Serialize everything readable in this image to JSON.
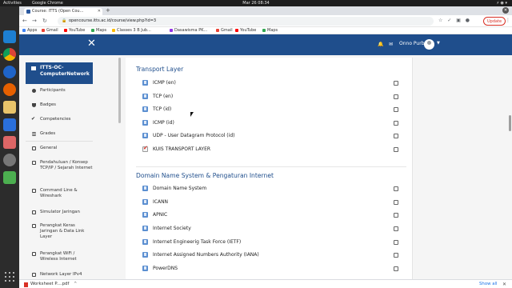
{
  "os": {
    "activities": "Activities",
    "app_name": "Google Chrome",
    "clock": "Mar 26  08:34"
  },
  "browser": {
    "tab_title": "Course: ITTS (Open Cou...",
    "url": "opencourse.itts.ac.id/course/view.php?id=3",
    "update_label": "Update",
    "bookmarks": [
      "Apps",
      "Gmail",
      "YouTube",
      "Maps",
      "Classes 3 B Jub...",
      "Dasawisma PK...",
      "Gmail",
      "YouTube",
      "Maps"
    ]
  },
  "header": {
    "user_name": "Onno Purbo"
  },
  "drawer": {
    "course_title": "ITTS-OC-ComputerNetwork",
    "items": [
      {
        "label": "Participants"
      },
      {
        "label": "Badges"
      },
      {
        "label": "Competencies"
      },
      {
        "label": "Grades"
      },
      {
        "label": "General"
      },
      {
        "label": "Pendahuluan / Konsep TCP/IP / Sejarah Internet"
      },
      {
        "label": "Command Line & Wireshark"
      },
      {
        "label": "Simulator Jaringan"
      },
      {
        "label": "Perangkat Keras Jaringan & Data Link Layer"
      },
      {
        "label": "Perangkat WiFi / Wireless Internet"
      },
      {
        "label": "Network Layer IPv4"
      }
    ]
  },
  "sections": [
    {
      "title": "Transport Layer",
      "activities": [
        {
          "label": "ICMP (en)",
          "type": "page"
        },
        {
          "label": "TCP (en)",
          "type": "page"
        },
        {
          "label": "TCP (id)",
          "type": "page"
        },
        {
          "label": "ICMP (id)",
          "type": "page"
        },
        {
          "label": "UDP - User Datagram Protocol (id)",
          "type": "page"
        },
        {
          "label": "KUIS TRANSPORT LAYER",
          "type": "quiz"
        }
      ]
    },
    {
      "title": "Domain Name System & Pengaturan Internet",
      "activities": [
        {
          "label": "Domain Name System",
          "type": "page"
        },
        {
          "label": "ICANN",
          "type": "page"
        },
        {
          "label": "APNIC",
          "type": "page"
        },
        {
          "label": "Internet Society",
          "type": "page"
        },
        {
          "label": "Internet Engineerig Task Force (IETF)",
          "type": "page"
        },
        {
          "label": "Internet Assigned Numbers Authority (IANA)",
          "type": "page"
        },
        {
          "label": "PowerDNS",
          "type": "page"
        }
      ]
    }
  ],
  "downloads": {
    "file_name": "Worksheet P....pdf",
    "show_all": "Show all"
  },
  "colors": {
    "brand": "#1f4e8c",
    "update": "#d93025",
    "link": "#1a73e8"
  }
}
